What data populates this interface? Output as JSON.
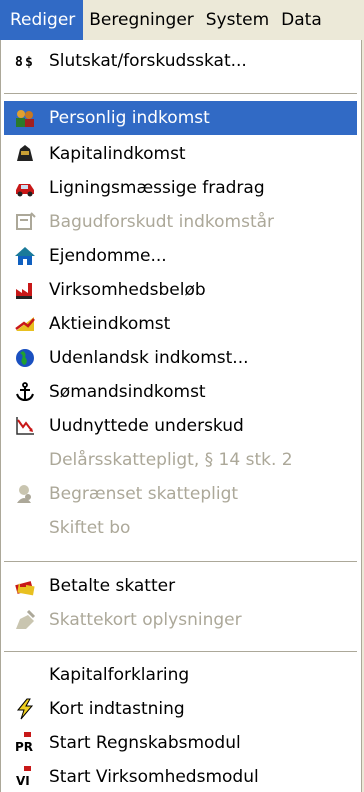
{
  "menubar": {
    "items": [
      "Rediger",
      "Beregninger",
      "System",
      "Data"
    ]
  },
  "menu": {
    "items": [
      {
        "label": "Slutskat/forskudsskat...",
        "icon": "slutskat-icon",
        "enabled": true
      },
      {
        "label": "Personlig indkomst",
        "icon": "people-icon",
        "enabled": true,
        "highlighted": true
      },
      {
        "label": "Kapitalindkomst",
        "icon": "money-bag-icon",
        "enabled": true
      },
      {
        "label": "Ligningsmæssige fradrag",
        "icon": "car-icon",
        "enabled": true
      },
      {
        "label": "Bagudforskudt indkomstår",
        "icon": "calendar-icon",
        "enabled": false
      },
      {
        "label": "Ejendomme...",
        "icon": "house-icon",
        "enabled": true
      },
      {
        "label": "Virksomhedsbeløb",
        "icon": "factory-icon",
        "enabled": true
      },
      {
        "label": "Aktieindkomst",
        "icon": "stock-icon",
        "enabled": true
      },
      {
        "label": "Udenlandsk indkomst...",
        "icon": "globe-icon",
        "enabled": true
      },
      {
        "label": "Sømandsindkomst",
        "icon": "anchor-icon",
        "enabled": true
      },
      {
        "label": "Uudnyttede underskud",
        "icon": "chart-arrow-icon",
        "enabled": true
      },
      {
        "label": "Delårsskattepligt, § 14 stk. 2",
        "icon": "",
        "enabled": false
      },
      {
        "label": "Begrænset skattepligt",
        "icon": "person-icon",
        "enabled": false
      },
      {
        "label": "Skiftet bo",
        "icon": "",
        "enabled": false
      },
      {
        "label": "Betalte skatter",
        "icon": "bills-icon",
        "enabled": true
      },
      {
        "label": "Skattekort oplysninger",
        "icon": "tax-card-icon",
        "enabled": false
      },
      {
        "label": "Kapitalforklaring",
        "icon": "",
        "enabled": true
      },
      {
        "label": "Kort indtastning",
        "icon": "lightning-icon",
        "enabled": true
      },
      {
        "label": "Start Regnskabsmodul",
        "icon": "pr-icon",
        "enabled": true
      },
      {
        "label": "Start Virksomhedsmodul",
        "icon": "vi-icon",
        "enabled": true
      }
    ]
  },
  "colors": {
    "highlight": "#316ac5",
    "disabled": "#aca899"
  }
}
